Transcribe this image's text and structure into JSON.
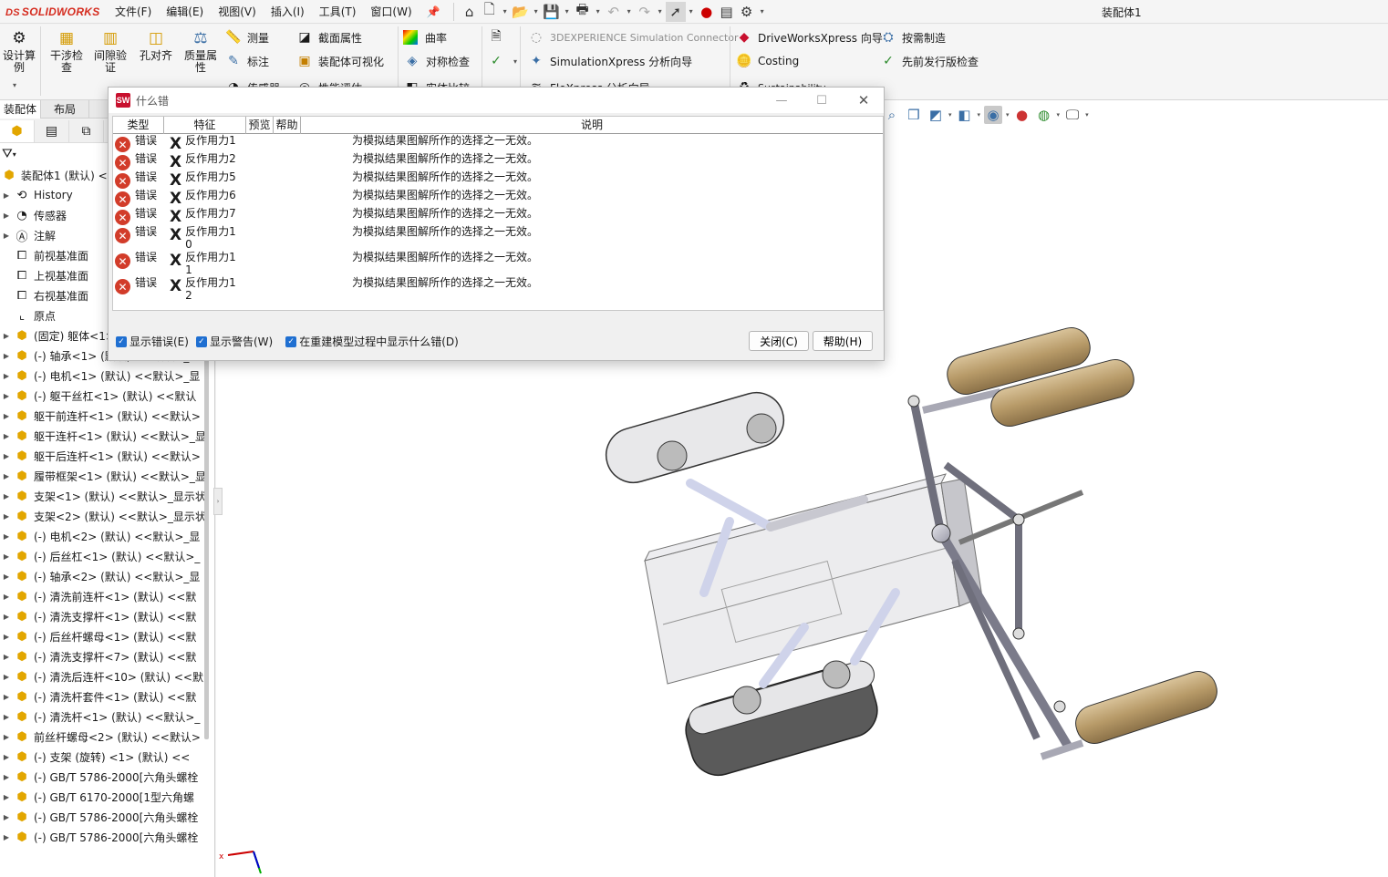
{
  "app": {
    "logo_mark": "DS",
    "logo_text": "SOLIDWORKS",
    "doc_title": "装配体1"
  },
  "menu": [
    "文件(F)",
    "编辑(E)",
    "视图(V)",
    "插入(I)",
    "工具(T)",
    "窗口(W)"
  ],
  "quick_access_icons": [
    "home-icon",
    "new-icon",
    "open-icon",
    "save-icon",
    "print-icon",
    "undo-icon",
    "redo-icon",
    "select-icon",
    "traffic-light-icon",
    "file-props-icon",
    "options-icon"
  ],
  "ribbon": {
    "big": [
      "设计算例",
      "干涉检查",
      "间隙验证",
      "孔对齐",
      "质量属性"
    ],
    "col1": [
      "测量",
      "标注",
      "传感器"
    ],
    "col2": [
      "截面属性",
      "装配体可视化",
      "性能评估"
    ],
    "col3": [
      "曲率",
      "对称检查",
      "实体比较"
    ],
    "col5": [
      "3DEXPERIENCE Simulation Connector",
      "SimulationXpress 分析向导",
      "FloXpress 分析向导"
    ],
    "col6": [
      "DriveWorksXpress 向导",
      "Costing",
      "Sustainability"
    ],
    "col7": [
      "按需制造",
      "先前发行版检查"
    ]
  },
  "cm_tabs": [
    "装配体",
    "布局"
  ],
  "tree": {
    "root": "装配体1 (默认) <默",
    "folders": [
      "History",
      "传感器",
      "注解",
      "前视基准面",
      "上视基准面",
      "右视基准面",
      "原点"
    ],
    "parts": [
      "(固定) 躯体<1> -> (默认) <<默",
      "(-) 轴承<1> (默认) <<默认>_显",
      "(-) 电机<1> (默认) <<默认>_显",
      "(-) 躯干丝杠<1> (默认) <<默认",
      "躯干前连杆<1> (默认) <<默认>",
      "躯干连杆<1> (默认) <<默认>_显",
      "躯干后连杆<1> (默认) <<默认>",
      "履带框架<1> (默认) <<默认>_显",
      "支架<1> (默认) <<默认>_显示状",
      "支架<2> (默认) <<默认>_显示状",
      "(-) 电机<2> (默认) <<默认>_显",
      "(-) 后丝杠<1> (默认) <<默认>_",
      "(-) 轴承<2> (默认) <<默认>_显",
      "(-) 清洗前连杆<1> (默认) <<默",
      "(-) 清洗支撑杆<1> (默认) <<默",
      "(-) 后丝杆螺母<1> (默认) <<默",
      "(-) 清洗支撑杆<7> (默认) <<默",
      "(-) 清洗后连杆<10> (默认) <<默",
      "(-) 清洗杆套件<1> (默认) <<默",
      "(-) 清洗杆<1> (默认) <<默认>_",
      "前丝杆螺母<2> (默认) <<默认>",
      "(-) 支架 (旋转) <1> (默认) <<",
      "(-) GB/T 5786-2000[六角头螺栓",
      "(-) GB/T 6170-2000[1型六角螺",
      "(-) GB/T 5786-2000[六角头螺栓",
      "(-) GB/T 5786-2000[六角头螺栓"
    ]
  },
  "dialog": {
    "title": "什么错",
    "columns": [
      "类型",
      "特征",
      "预览",
      "帮助",
      "说明"
    ],
    "rows": [
      {
        "type": "错误",
        "feature": "反作用力1",
        "desc": "为模拟结果图解所作的选择之一无效。"
      },
      {
        "type": "错误",
        "feature": "反作用力2",
        "desc": "为模拟结果图解所作的选择之一无效。"
      },
      {
        "type": "错误",
        "feature": "反作用力5",
        "desc": "为模拟结果图解所作的选择之一无效。"
      },
      {
        "type": "错误",
        "feature": "反作用力6",
        "desc": "为模拟结果图解所作的选择之一无效。"
      },
      {
        "type": "错误",
        "feature": "反作用力7",
        "desc": "为模拟结果图解所作的选择之一无效。"
      },
      {
        "type": "错误",
        "feature": "反作用力10",
        "desc": "为模拟结果图解所作的选择之一无效。"
      },
      {
        "type": "错误",
        "feature": "反作用力11",
        "desc": "为模拟结果图解所作的选择之一无效。"
      },
      {
        "type": "错误",
        "feature": "反作用力12",
        "desc": "为模拟结果图解所作的选择之一无效。"
      }
    ],
    "options": [
      "显示错误(E)",
      "显示警告(W)",
      "在重建模型过程中显示什么错(D)"
    ],
    "close_label": "关闭(C)",
    "help_label": "帮助(H)"
  },
  "triad": {
    "x_label": "x"
  },
  "colors": {
    "error": "#d23c2a",
    "brand": "#d52b1e",
    "checkbox": "#1f6fd1"
  }
}
